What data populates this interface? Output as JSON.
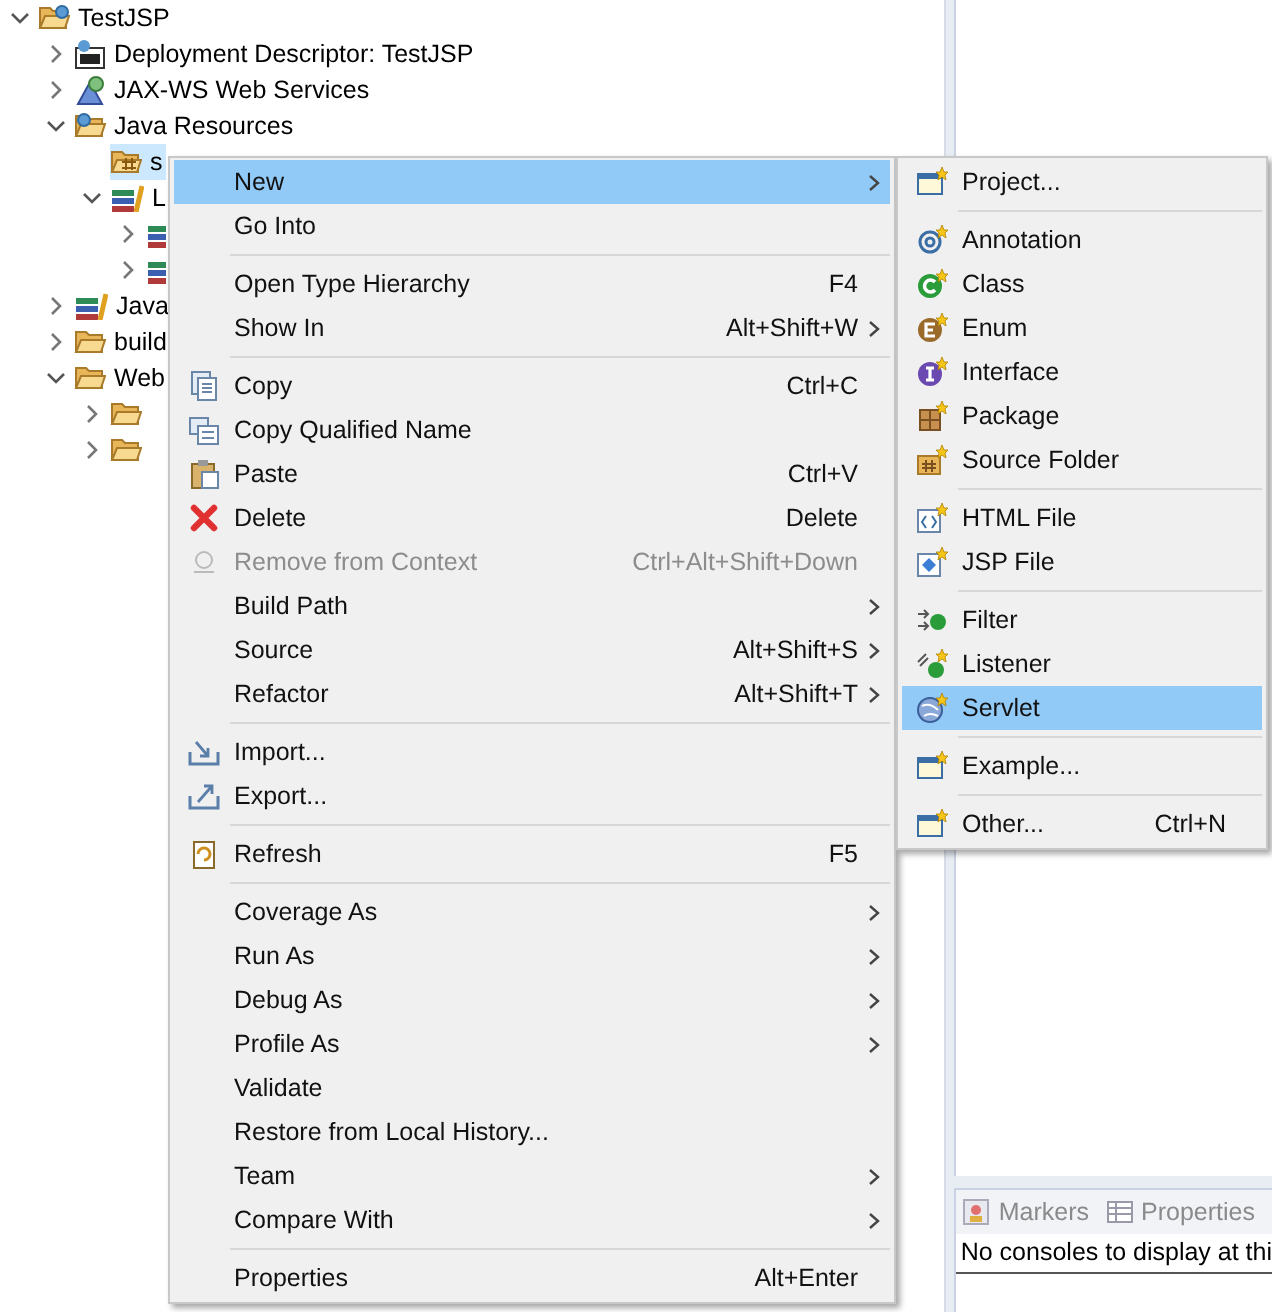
{
  "tree": [
    {
      "label": "TestJSP",
      "kind": "project",
      "expanded": true,
      "children": [
        {
          "label": "Deployment Descriptor: TestJSP",
          "kind": "descriptor",
          "expanded": false
        },
        {
          "label": "JAX-WS Web Services",
          "kind": "webservice",
          "expanded": false
        },
        {
          "label": "Java Resources",
          "kind": "resources",
          "expanded": true,
          "children": [
            {
              "label": "s",
              "kind": "package-folder",
              "selected": true
            },
            {
              "label": "L",
              "kind": "library",
              "expanded": true,
              "selected": false,
              "children": [
                {
                  "kind": "library",
                  "expanded": false
                },
                {
                  "kind": "library",
                  "expanded": false
                }
              ]
            }
          ]
        },
        {
          "label": "Java",
          "kind": "library",
          "expanded": false
        },
        {
          "label": "build",
          "kind": "folder",
          "expanded": false
        },
        {
          "label": "Web",
          "kind": "folder",
          "expanded": true,
          "children": [
            {
              "kind": "folder",
              "expanded": false
            },
            {
              "kind": "folder",
              "expanded": false
            }
          ]
        }
      ]
    }
  ],
  "context_menu": [
    {
      "kind": "item",
      "label": "New",
      "submenu": true,
      "selected": true
    },
    {
      "kind": "item",
      "label": "Go Into",
      "selected": false
    },
    {
      "kind": "separator"
    },
    {
      "kind": "item",
      "label": "Open Type Hierarchy",
      "shortcut": "F4",
      "selected": false
    },
    {
      "kind": "item",
      "label": "Show In",
      "shortcut": "Alt+Shift+W",
      "submenu": true,
      "selected": false
    },
    {
      "kind": "separator"
    },
    {
      "kind": "item",
      "label": "Copy",
      "shortcut": "Ctrl+C",
      "selected": false
    },
    {
      "kind": "item",
      "label": "Copy Qualified Name",
      "selected": false
    },
    {
      "kind": "item",
      "label": "Paste",
      "shortcut": "Ctrl+V",
      "selected": false
    },
    {
      "kind": "item",
      "label": "Delete",
      "shortcut": "Delete",
      "selected": false
    },
    {
      "kind": "item",
      "label": "Remove from Context",
      "shortcut": "Ctrl+Alt+Shift+Down",
      "disabled": true,
      "selected": false
    },
    {
      "kind": "item",
      "label": "Build Path",
      "submenu": true,
      "selected": false
    },
    {
      "kind": "item",
      "label": "Source",
      "shortcut": "Alt+Shift+S",
      "submenu": true,
      "selected": false
    },
    {
      "kind": "item",
      "label": "Refactor",
      "shortcut": "Alt+Shift+T",
      "submenu": true,
      "selected": false
    },
    {
      "kind": "separator"
    },
    {
      "kind": "item",
      "label": "Import...",
      "selected": false
    },
    {
      "kind": "item",
      "label": "Export...",
      "selected": false
    },
    {
      "kind": "separator"
    },
    {
      "kind": "item",
      "label": "Refresh",
      "shortcut": "F5",
      "selected": false
    },
    {
      "kind": "separator"
    },
    {
      "kind": "item",
      "label": "Coverage As",
      "submenu": true,
      "selected": false
    },
    {
      "kind": "item",
      "label": "Run As",
      "submenu": true,
      "selected": false
    },
    {
      "kind": "item",
      "label": "Debug As",
      "submenu": true,
      "selected": false
    },
    {
      "kind": "item",
      "label": "Profile As",
      "submenu": true,
      "selected": false
    },
    {
      "kind": "item",
      "label": "Validate",
      "selected": false
    },
    {
      "kind": "item",
      "label": "Restore from Local History...",
      "selected": false
    },
    {
      "kind": "item",
      "label": "Team",
      "submenu": true,
      "selected": false
    },
    {
      "kind": "item",
      "label": "Compare With",
      "submenu": true,
      "selected": false
    },
    {
      "kind": "separator"
    },
    {
      "kind": "item",
      "label": "Properties",
      "shortcut": "Alt+Enter",
      "selected": false
    }
  ],
  "new_submenu": [
    {
      "kind": "item",
      "label": "Project...",
      "selected": false
    },
    {
      "kind": "separator"
    },
    {
      "kind": "item",
      "label": "Annotation",
      "selected": false
    },
    {
      "kind": "item",
      "label": "Class",
      "selected": false
    },
    {
      "kind": "item",
      "label": "Enum",
      "selected": false
    },
    {
      "kind": "item",
      "label": "Interface",
      "selected": false
    },
    {
      "kind": "item",
      "label": "Package",
      "selected": false
    },
    {
      "kind": "item",
      "label": "Source Folder",
      "selected": false
    },
    {
      "kind": "separator"
    },
    {
      "kind": "item",
      "label": "HTML File",
      "selected": false
    },
    {
      "kind": "item",
      "label": "JSP File",
      "selected": false
    },
    {
      "kind": "separator"
    },
    {
      "kind": "item",
      "label": "Filter",
      "selected": false
    },
    {
      "kind": "item",
      "label": "Listener",
      "selected": false
    },
    {
      "kind": "item",
      "label": "Servlet",
      "selected": true
    },
    {
      "kind": "separator"
    },
    {
      "kind": "item",
      "label": "Example...",
      "selected": false
    },
    {
      "kind": "separator"
    },
    {
      "kind": "item",
      "label": "Other...",
      "shortcut": "Ctrl+N",
      "selected": false
    }
  ],
  "bottom_panel": {
    "tabs": [
      {
        "label": "Markers",
        "selected": false
      },
      {
        "label": "Properties",
        "selected": false
      }
    ],
    "message": "No consoles to display at thi"
  }
}
